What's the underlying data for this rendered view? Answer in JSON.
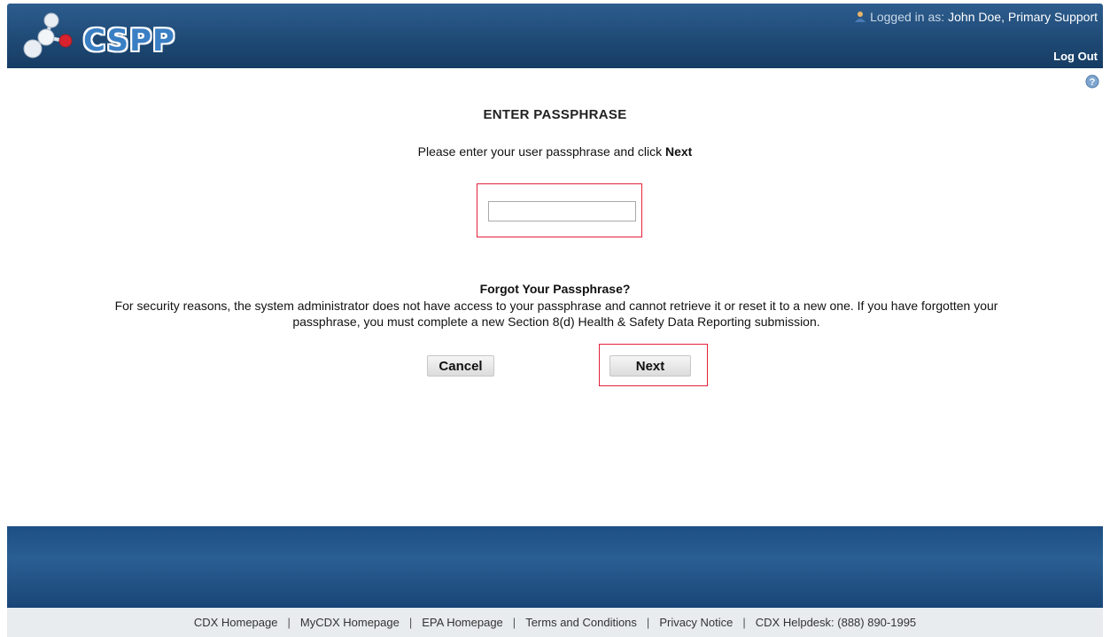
{
  "header": {
    "logo_text": "CSPP",
    "logged_in_label": "Logged in as:",
    "user_name": "John Doe, Primary Support",
    "logout_label": "Log Out"
  },
  "main": {
    "title": "ENTER PASSPHRASE",
    "instruction_prefix": "Please enter your user passphrase and click",
    "instruction_bold": "Next",
    "passphrase_value": "",
    "forgot_title": "Forgot Your Passphrase?",
    "forgot_text_line1": "For security reasons, the system administrator does not have access to your passphrase and cannot retrieve it or reset it to a new one. If you have forgotten your",
    "forgot_text_line2": "passphrase, you must complete a new Section 8(d) Health & Safety Data Reporting submission.",
    "cancel_label": "Cancel",
    "next_label": "Next"
  },
  "footer": {
    "links": [
      "CDX Homepage",
      "MyCDX Homepage",
      "EPA Homepage",
      "Terms and Conditions",
      "Privacy Notice",
      "CDX Helpdesk: (888) 890-1995"
    ],
    "separator": "|"
  },
  "icons": {
    "user": "user-icon",
    "help": "help-icon",
    "logo": "molecule-logo-icon"
  },
  "colors": {
    "header_blue": "#1f4a76",
    "logo_blue": "#3a7fc4",
    "highlight_red": "#e2223a",
    "footer_blue": "#2a5f93"
  }
}
